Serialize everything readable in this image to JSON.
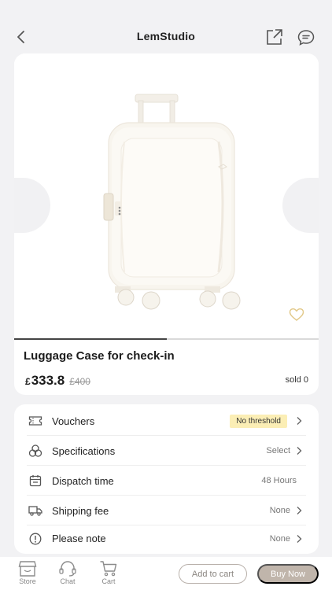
{
  "header": {
    "title": "LemStudio",
    "back_icon": "chevron-left-icon",
    "share_icon": "share-icon",
    "chat_icon": "chat-bubble-icon"
  },
  "gallery": {
    "image_subject": "white hard-shell luggage case",
    "progress_fraction": 0.5,
    "favorite_icon": "heart-icon"
  },
  "product": {
    "name": "Luggage Case for check-in",
    "currency": "£",
    "price": "333.8",
    "original_price": "£400",
    "sold": "sold 0"
  },
  "info": {
    "rows": [
      {
        "label": "Vouchers",
        "value": "No threshold",
        "icon": "ticket-icon",
        "style": "badge"
      },
      {
        "label": "Specifications",
        "value": "Select",
        "icon": "cubes-icon",
        "style": "chevron"
      },
      {
        "label": "Dispatch time",
        "value": "48 Hours",
        "icon": "calendar-icon",
        "style": "plain"
      },
      {
        "label": "Shipping fee",
        "value": "None",
        "icon": "truck-icon",
        "style": "chevron"
      },
      {
        "label": "Please note",
        "value": "None",
        "icon": "info-icon",
        "style": "chevron"
      }
    ]
  },
  "bottom": {
    "tabs": [
      {
        "label": "Store",
        "icon": "store-icon"
      },
      {
        "label": "Chat",
        "icon": "headset-icon"
      },
      {
        "label": "Cart",
        "icon": "cart-icon"
      }
    ],
    "add_to_cart": "Add to cart",
    "buy_now": "Buy Now"
  },
  "colors": {
    "background": "#f2f2f4",
    "badge": "#fbeeb5",
    "buy_button": "#c0b5ab",
    "cart_border": "#b9b1ab"
  }
}
